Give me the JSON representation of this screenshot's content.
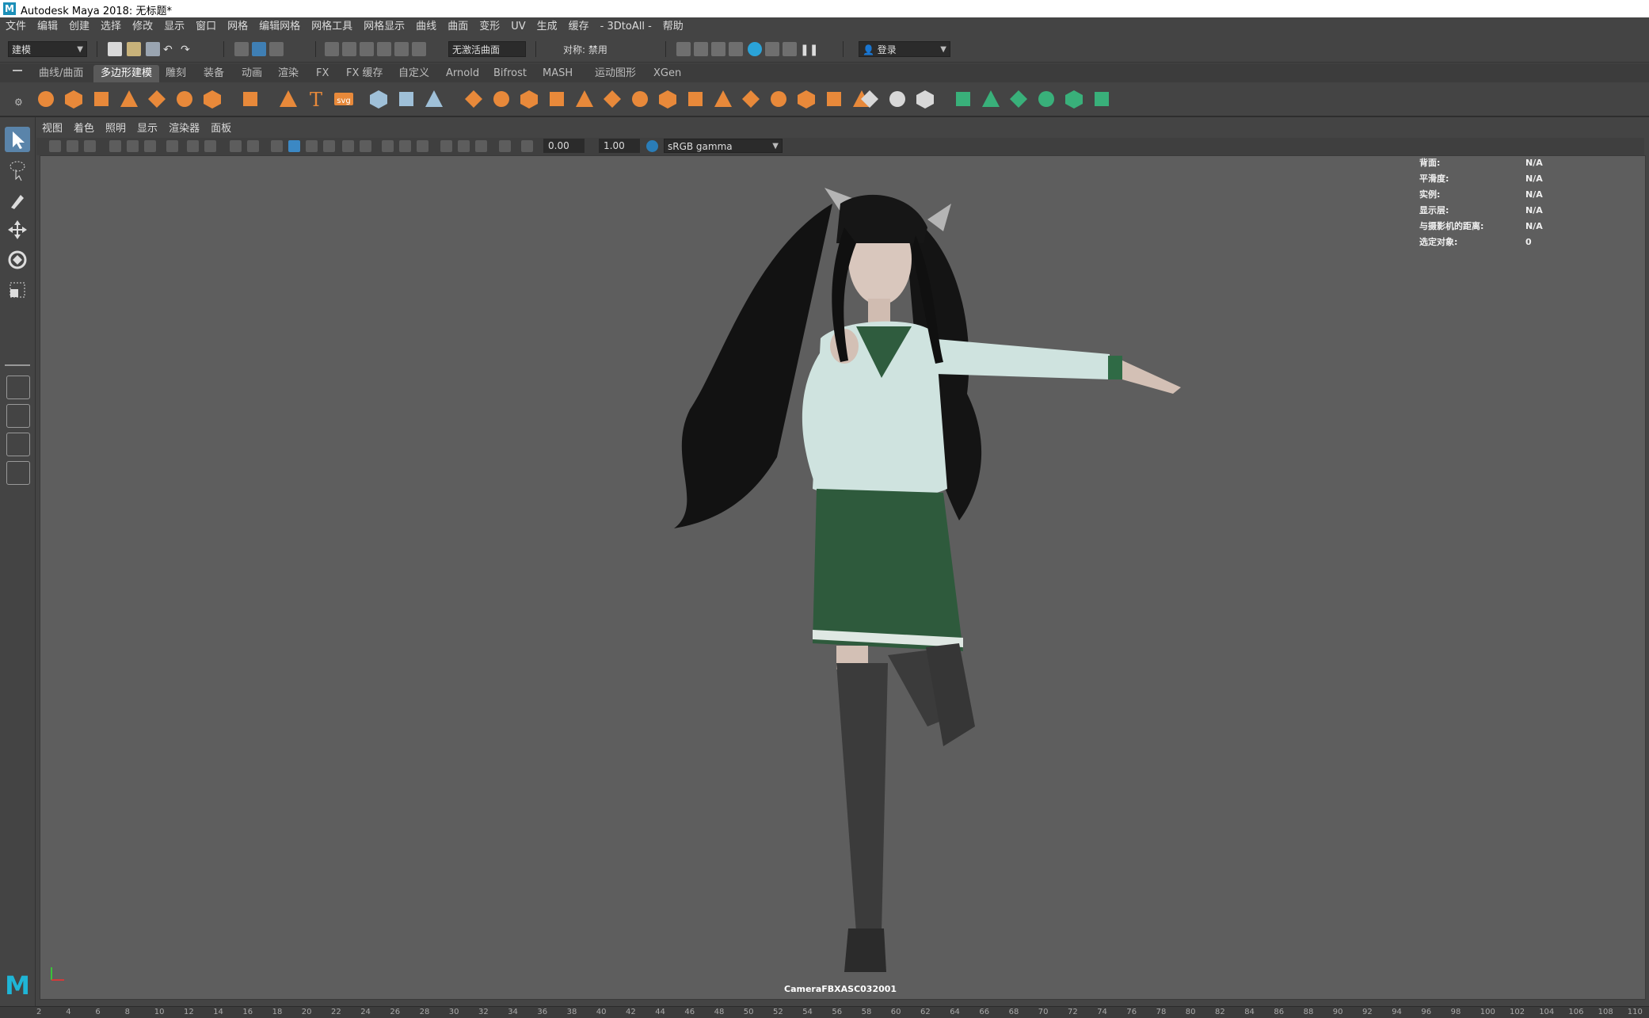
{
  "window": {
    "title": "Autodesk Maya 2018: 无标题*",
    "logo": "M"
  },
  "menubar": [
    "文件",
    "编辑",
    "创建",
    "选择",
    "修改",
    "显示",
    "窗口",
    "网格",
    "编辑网格",
    "网格工具",
    "网格显示",
    "曲线",
    "曲面",
    "变形",
    "UV",
    "生成",
    "缓存",
    "- 3DtoAll -",
    "帮助"
  ],
  "statusline": {
    "mode": "建模",
    "live_surface": "无激活曲面",
    "symmetry": "对称: 禁用",
    "login": "登录"
  },
  "shelf_tabs": {
    "items": [
      "曲线/曲面",
      "多边形建模",
      "雕刻",
      "装备",
      "动画",
      "渲染",
      "FX",
      "FX 缓存",
      "自定义",
      "Arnold",
      "Bifrost",
      "MASH",
      "运动图形",
      "XGen"
    ],
    "active": "多边形建模"
  },
  "shelf_icons": [
    "sphere-icon",
    "cube-icon",
    "cylinder-icon",
    "cone-icon",
    "torus-icon",
    "plane-icon",
    "disc-icon",
    "platonic-icon",
    "super-shape-icon",
    "type-icon",
    "svg-icon",
    "measure-icon",
    "uv-icon",
    "pivot-icon",
    "combine-icon",
    "separate-icon",
    "extract-icon",
    "smooth-icon",
    "boolean-icon",
    "mirror-icon",
    "bridge-icon",
    "fill-hole-icon",
    "collapse-icon",
    "extrude-icon",
    "bevel-icon",
    "multi-cut-icon",
    "target-weld-icon",
    "edge-loop-icon",
    "uv-editor-icon",
    "planar-map-icon",
    "auto-map-icon",
    "cut-uv-icon",
    "sew-uv-icon",
    "unfold-icon",
    "layout-icon",
    "checker-icon",
    "symmetry-icon",
    "close-icon"
  ],
  "shelf_svg_label": "svg",
  "panel_menu": [
    "视图",
    "着色",
    "照明",
    "显示",
    "渲染器",
    "面板"
  ],
  "panel_toolbar": {
    "exposure": "0.00",
    "gamma": "1.00",
    "color_space": "sRGB gamma"
  },
  "hud": [
    {
      "label": "背面:",
      "value": "N/A"
    },
    {
      "label": "平滑度:",
      "value": "N/A"
    },
    {
      "label": "实例:",
      "value": "N/A"
    },
    {
      "label": "显示层:",
      "value": "N/A"
    },
    {
      "label": "与摄影机的距离:",
      "value": "N/A"
    },
    {
      "label": "选定对象:",
      "value": "0"
    }
  ],
  "camera_label": "CameraFBXASC032001",
  "time_slider": {
    "ticks": [
      "2",
      "4",
      "6",
      "8",
      "10",
      "12",
      "14",
      "16",
      "18",
      "20",
      "22",
      "24",
      "26",
      "28",
      "30",
      "32",
      "34",
      "36",
      "38",
      "40",
      "42",
      "44",
      "46",
      "48",
      "50",
      "52",
      "54",
      "56",
      "58",
      "60",
      "62",
      "64",
      "66",
      "68",
      "70",
      "72",
      "74",
      "76",
      "78",
      "80",
      "82",
      "84",
      "86",
      "88",
      "90",
      "92",
      "94",
      "96",
      "98",
      "100",
      "102",
      "104",
      "106",
      "108",
      "110"
    ]
  },
  "colors": {
    "shelf_accent": "#e8893a",
    "poly_green": "#39b07a",
    "viewport_bg": "#5e5e5e"
  }
}
